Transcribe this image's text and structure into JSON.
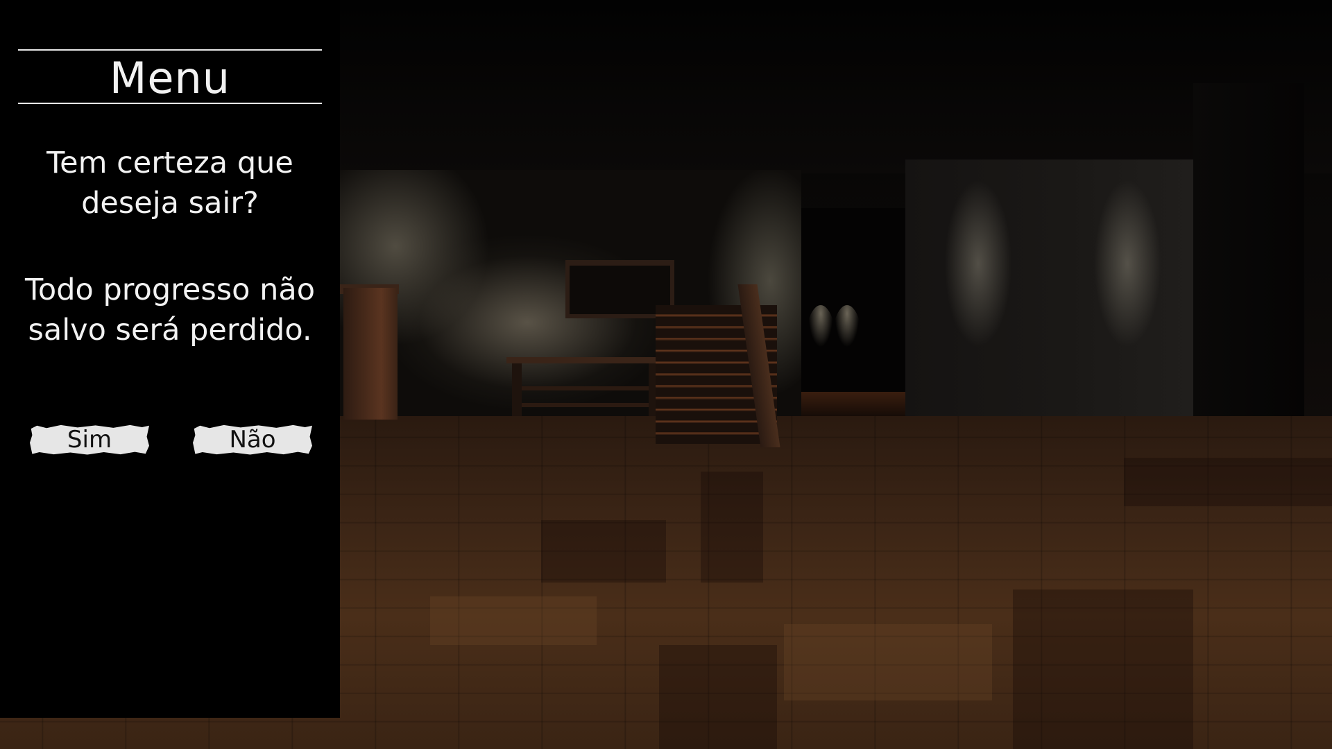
{
  "menu": {
    "title": "Menu",
    "confirm_question": [
      "Tem certeza que",
      "deseja sair?"
    ],
    "warning": [
      "Todo progresso não",
      "salvo será perdido."
    ],
    "yes_label": "Sim",
    "no_label": "Não"
  },
  "colors": {
    "panel_background": "#000000",
    "panel_text": "#f2f2f2",
    "button_background": "#e6e6e6",
    "button_text": "#111111"
  },
  "icons": {
    "scene": "dark-wooden-house-interior"
  }
}
